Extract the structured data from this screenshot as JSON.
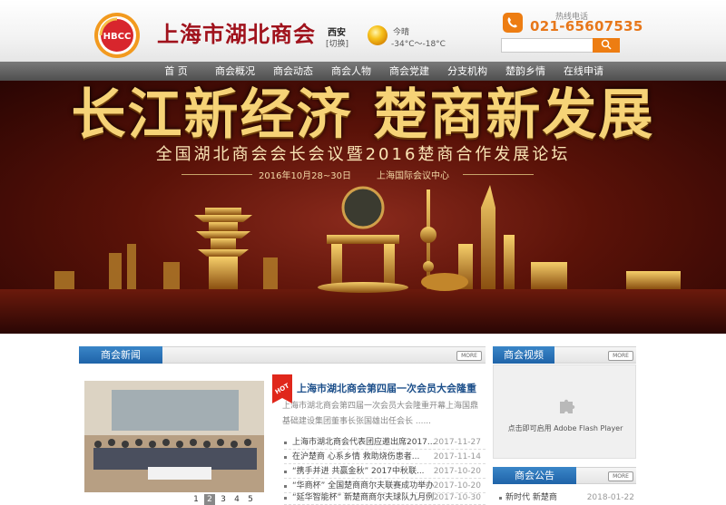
{
  "header": {
    "logo_text": "HBCC",
    "site_name": "上海市湖北商会",
    "city": "西安",
    "city_switch": "[切换]",
    "weather_label": "今晴",
    "weather_temp": "-34°C～-18°C",
    "hotline_label": "热线电话",
    "hotline_number": "021-65607535",
    "search_placeholder": "",
    "search_icon": "search-icon"
  },
  "nav": {
    "items": [
      {
        "label": "首 页"
      },
      {
        "label": "商会概况"
      },
      {
        "label": "商会动态"
      },
      {
        "label": "商会人物"
      },
      {
        "label": "商会党建"
      },
      {
        "label": "分支机构"
      },
      {
        "label": "楚韵乡情"
      },
      {
        "label": "在线申请"
      }
    ]
  },
  "banner": {
    "title": "长江新经济 楚商新发展",
    "subtitle": "全国湖北商会会长会议暨2016楚商合作发展论坛",
    "date": "2016年10月28~30日",
    "venue": "上海国际会议中心"
  },
  "news": {
    "tab_label": "商会新闻",
    "more_label": "MORE",
    "hot_label": "HOT",
    "headline": "上海市湖北商会第四届一次会员大会隆重",
    "summary": "上海市湖北商会第四届一次会员大会隆重开幕上海国鼎基础建设集团董事长张国雄出任会长 ......",
    "pager": [
      "1",
      "2",
      "3",
      "4",
      "5"
    ],
    "active_page": "2",
    "items": [
      {
        "title": "上海市湖北商会代表团应邀出席2017...",
        "date": "2017-11-27"
      },
      {
        "title": "在沪楚商 心系乡情 救助烧伤患者...",
        "date": "2017-11-14"
      },
      {
        "title": "“携手并进 共赢金秋” 2017中秋联...",
        "date": "2017-10-20"
      },
      {
        "title": "“华商杯” 全国楚商商尔夫联赛成功举办",
        "date": "2017-10-20"
      },
      {
        "title": "“延华智能杯” 新楚商商尔夫球队九月例...",
        "date": "2017-10-30"
      }
    ]
  },
  "video": {
    "tab_label": "商会视频",
    "more_label": "MORE",
    "flash_text": "点击即可启用 Adobe Flash Player"
  },
  "notice": {
    "tab_label": "商会公告",
    "more_label": "MORE",
    "items": [
      {
        "title": "新时代 新楚商",
        "date": "2018-01-22"
      }
    ]
  }
}
